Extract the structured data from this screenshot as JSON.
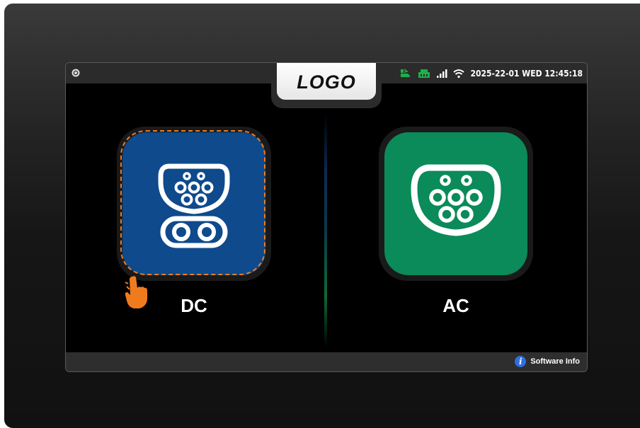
{
  "status_bar": {
    "datetime": "2025-22-01 WED 12:45:18",
    "icons": [
      "settings-icon",
      "charger-status-icon",
      "network-status-icon",
      "signal-bars-icon",
      "wifi-icon"
    ],
    "colors": {
      "status_green": "#1fae4b",
      "background": "#2b2b2b"
    }
  },
  "header": {
    "logo_text": "LOGO"
  },
  "options": [
    {
      "id": "dc",
      "label": "DC",
      "color": "#0e4a8c",
      "selected": true,
      "icon": "ccs-connector-icon"
    },
    {
      "id": "ac",
      "label": "AC",
      "color": "#0b8a5a",
      "selected": false,
      "icon": "type2-connector-icon"
    }
  ],
  "selection_color": "#f07b1e",
  "footer": {
    "software_info_label": "Software Info",
    "icon": "info-icon"
  }
}
